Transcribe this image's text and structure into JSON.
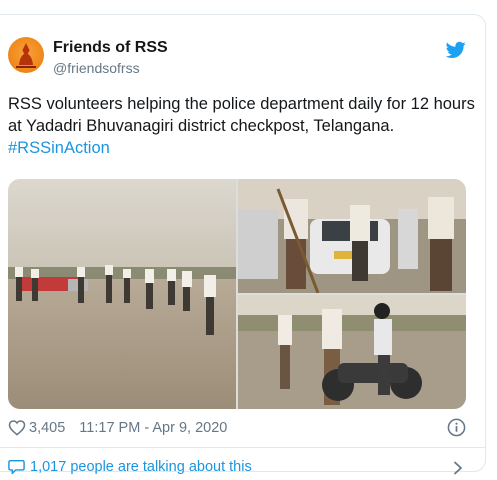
{
  "tweet": {
    "author_name": "Friends of RSS",
    "author_handle": "@friendsofrss",
    "text": "RSS volunteers helping the police department daily for 12 hours at Yadadri Bhuvanagiri district checkpost, Telangana.",
    "hashtag": "#RSSinAction",
    "like_count": "3,405",
    "timestamp": "11:17 PM - Apr 9, 2020",
    "conversation_text": "1,017 people are talking about this"
  },
  "icons": {
    "brand": "twitter-bird-icon",
    "like": "heart-icon",
    "info": "info-icon",
    "conversation": "speech-bubble-icon",
    "more": "chevron-right-icon"
  },
  "colors": {
    "link": "#1b95e0",
    "secondary_text": "#657786",
    "avatar": "#f08a1c"
  }
}
